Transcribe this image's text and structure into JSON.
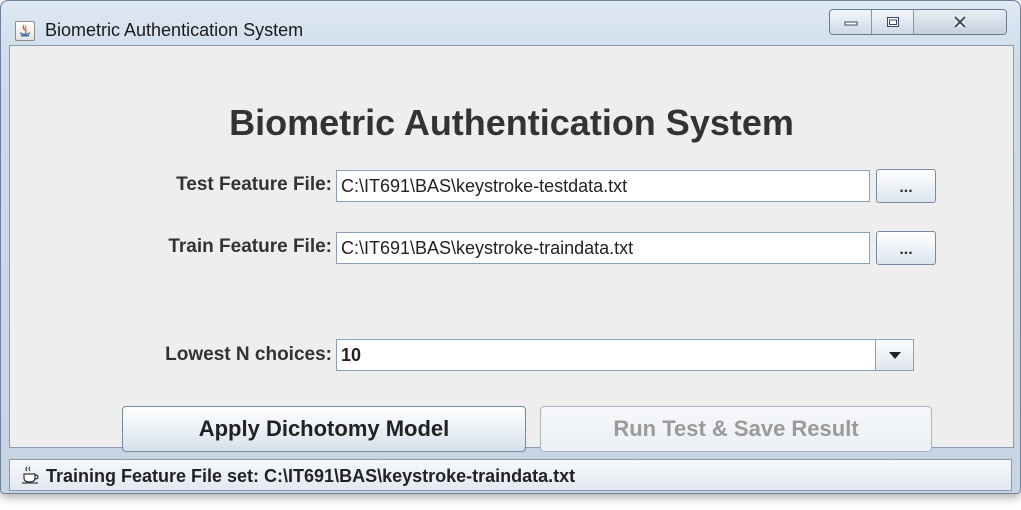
{
  "window": {
    "title": "Biometric Authentication System",
    "controls": {
      "minimize_icon": "minimize-icon",
      "maximize_icon": "maximize-icon",
      "close_icon": "close-icon"
    }
  },
  "main": {
    "heading": "Biometric Authentication System",
    "test_file": {
      "label": "Test Feature File:",
      "value": "C:\\IT691\\BAS\\keystroke-testdata.txt",
      "browse_label": "..."
    },
    "train_file": {
      "label": "Train Feature File:",
      "value": "C:\\IT691\\BAS\\keystroke-traindata.txt",
      "browse_label": "..."
    },
    "lowest_n": {
      "label": "Lowest N choices:",
      "selected": "10"
    },
    "buttons": {
      "apply": "Apply Dichotomy Model",
      "run": "Run Test & Save Result"
    }
  },
  "status": {
    "icon": "java-cup-icon",
    "text": "Training Feature File set: C:\\IT691\\BAS\\keystroke-traindata.txt"
  },
  "colors": {
    "titlebar": "#cfdbe9",
    "content_bg": "#eeeeee",
    "disabled_text": "#9a9a9a"
  }
}
